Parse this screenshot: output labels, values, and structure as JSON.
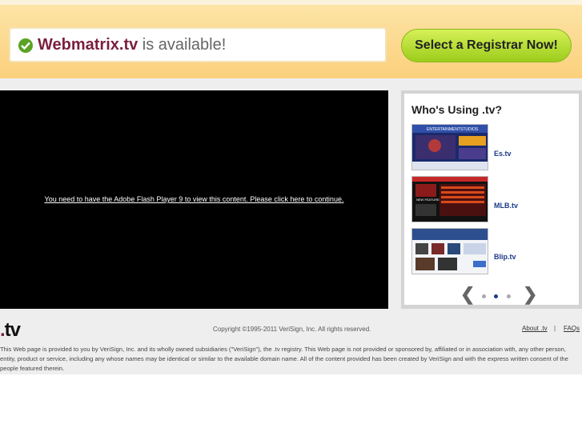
{
  "banner": {
    "domain": "Webmatrix.tv",
    "status_text": "is available!",
    "cta_label": "Select a Registrar Now!"
  },
  "flash": {
    "message": "You need to have the Adobe Flash Player 9 to view this content. Please click here to continue."
  },
  "showcase": {
    "title": "Who's Using .tv?",
    "sites": [
      {
        "label": "Es.tv",
        "thumb_banner": "ENTERTAINMENTSTUDIOS"
      },
      {
        "label": "MLB.tv",
        "thumb_banner": "NEW FEATURES"
      },
      {
        "label": "Blip.tv",
        "thumb_banner": ""
      }
    ],
    "carousel": {
      "page": 2,
      "pages": 3
    }
  },
  "footer": {
    "logo_text": "tv",
    "copyright": "Copyright ©1995-2011 VeriSign, Inc. All rights reserved.",
    "links": [
      "About .tv",
      "FAQs"
    ],
    "separator": "|",
    "disclaimer": "This Web page is provided to you by VeriSign, Inc. and its wholly owned subsidiaries (\"VeriSign\"), the .tv registry. This Web page is not provided or sponsored by, affiliated or in association with, any other person, entity, product or service, including any whose names may be identical or similar to the available domain name. All of the content provided has been created by VeriSign and with the express written consent of the people featured therein."
  },
  "colors": {
    "brand_maroon": "#7a1f3e",
    "cta_green": "#9ccd1c",
    "link_blue": "#1d3a8a",
    "banner_orange": "#fbd07c"
  }
}
